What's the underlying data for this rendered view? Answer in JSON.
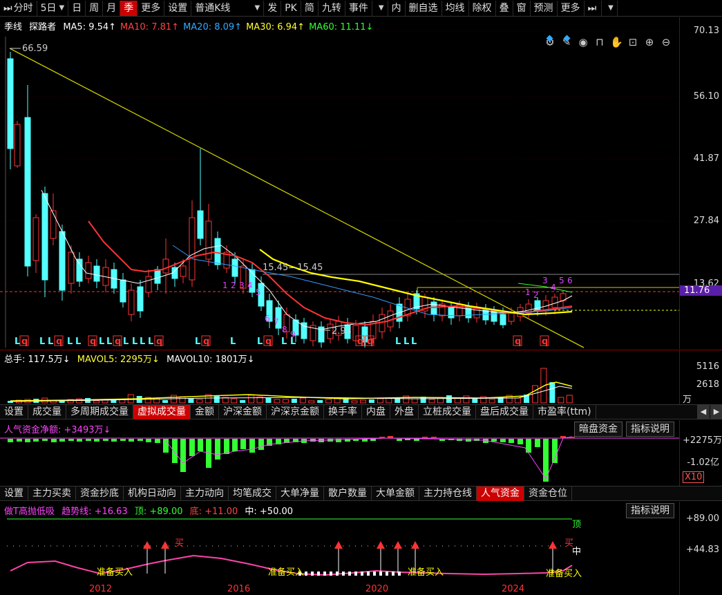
{
  "toolbar": {
    "items": [
      {
        "label": "分时",
        "icon": "play-step-icon"
      },
      {
        "label": "5日",
        "has_caret": true
      },
      {
        "label": "日"
      },
      {
        "label": "周"
      },
      {
        "label": "月"
      },
      {
        "label": "季",
        "active": true
      },
      {
        "label": "更多"
      },
      {
        "label": "设置"
      },
      {
        "label": "普通K线",
        "has_caret": true,
        "wide": true
      },
      {
        "label": "发"
      },
      {
        "label": "PK"
      },
      {
        "label": "简"
      },
      {
        "label": "九转"
      },
      {
        "label": "事件"
      },
      {
        "label": "",
        "has_caret": true
      },
      {
        "label": "内"
      },
      {
        "label": "删自选"
      },
      {
        "label": "均线"
      },
      {
        "label": "除权"
      },
      {
        "label": "叠"
      },
      {
        "label": "窗"
      },
      {
        "label": "预测"
      },
      {
        "label": "更多"
      },
      {
        "label": "",
        "icon": "play-step-icon"
      },
      {
        "label": "",
        "has_caret": true
      }
    ]
  },
  "main_chart": {
    "period": "季线",
    "stock_name": "探路者",
    "ma": [
      {
        "label": "MA5: 9.54↑",
        "color": "#ffffff"
      },
      {
        "label": "MA10: 7.81↑",
        "color": "#ff4444"
      },
      {
        "label": "MA20: 8.09↑",
        "color": "#33aaff"
      },
      {
        "label": "MA30: 6.94↑",
        "color": "#ffff33"
      },
      {
        "label": "MA60: 11.11↓",
        "color": "#33ff33"
      }
    ],
    "y_axis": [
      "70.13",
      "56.10",
      "41.87",
      "27.84",
      "13.62"
    ],
    "current_price": "11.76",
    "high_mark": "66.59",
    "low_mark": "2.93",
    "hline_label": "15.45—15.45",
    "x_axis": [
      "2012",
      "2016",
      "2020",
      "2024"
    ]
  },
  "volume": {
    "label": "总手: 117.5万↓",
    "mavol5": "MAVOL5: 2295万↓",
    "mavol10": "MAVOL10: 1801万↓",
    "y_axis": [
      "5116",
      "2618",
      "万"
    ]
  },
  "tabs1": [
    "设置",
    "成交量",
    "多周期成交量",
    "虚拟成交量",
    "金额",
    "沪深金额",
    "沪深京金额",
    "换手率",
    "内盘",
    "外盘",
    "立桩成交量",
    "盘后成交量",
    "市盈率(ttm)"
  ],
  "tabs1_active": 3,
  "money": {
    "label": "人气资金净额: +3493万↓",
    "btn_dark": "暗盘资金",
    "btn_explain": "指标说明",
    "y_axis": [
      "+2275万",
      "-1.02亿",
      "X10"
    ]
  },
  "tabs2": [
    "设置",
    "主力买卖",
    "资金抄底",
    "机构日动向",
    "主力动向",
    "均笔成交",
    "大单净量",
    "散户数量",
    "大单金额",
    "主力持仓线",
    "人气资金",
    "资金仓位"
  ],
  "tabs2_active": 10,
  "t_indicator": {
    "name": "做T高抛低吸",
    "trend": "趋势线: +16.63",
    "top": "顶: +89.00",
    "bottom": "底: +11.00",
    "mid": "中: +50.00",
    "btn_explain": "指标说明",
    "y_axis": [
      "+89.00",
      "+44.83"
    ],
    "label_top": "顶",
    "label_mid": "中",
    "label_buy": "买",
    "label_ready": "准备买入"
  },
  "colors": {
    "up": "#ff3333",
    "down": "#54ffff",
    "accent": "#cc0000"
  }
}
